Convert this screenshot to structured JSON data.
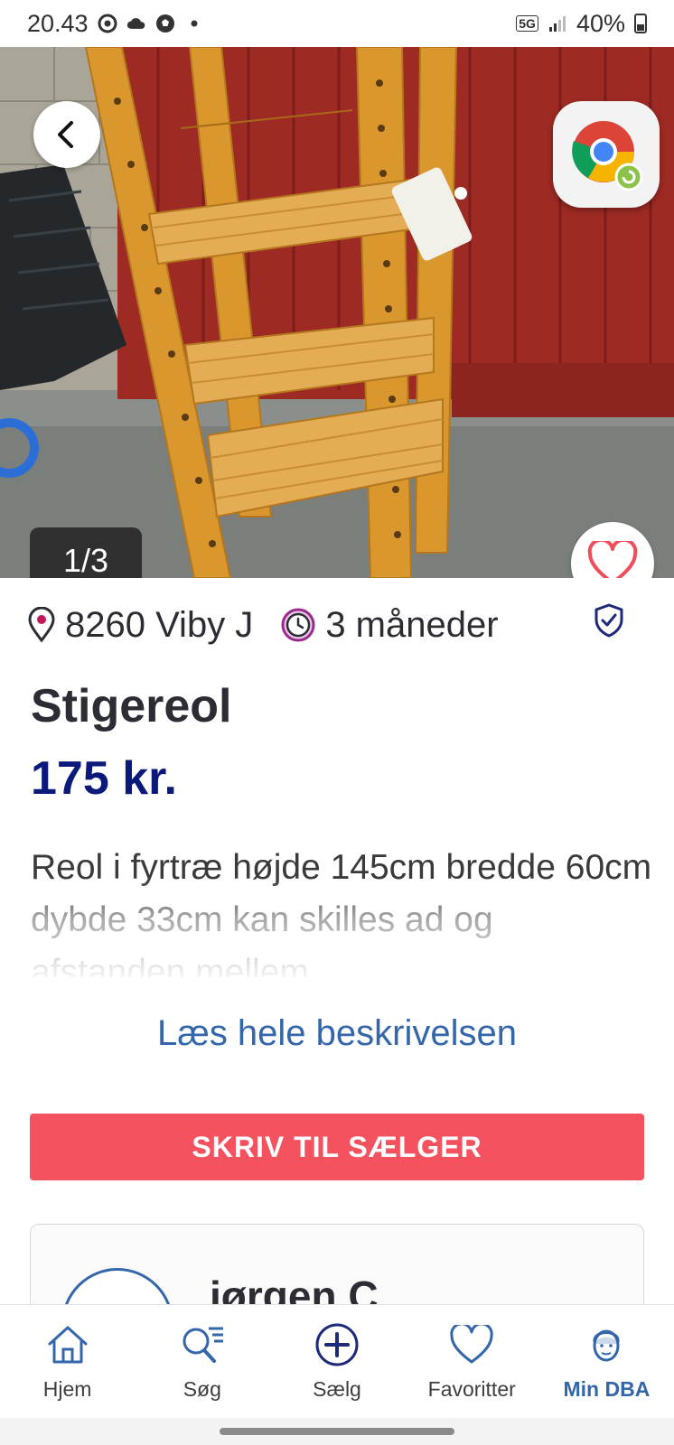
{
  "status_bar": {
    "time": "20.43",
    "network": "5G",
    "battery": "40%",
    "icons": [
      "chrome-status-icon",
      "cloud-icon",
      "football-icon",
      "dot-icon",
      "signal-icon",
      "battery-icon"
    ]
  },
  "listing": {
    "photo_counter": "1/3",
    "location": "8260 Viby J",
    "age": "3 måneder",
    "title": "Stigereol",
    "price": "175 kr.",
    "description": "Reol i fyrtræ højde 145cm bredde 60cm dybde 33cm kan skilles ad og afstanden mellem",
    "read_more": "Læs hele beskrivelsen",
    "contact_button": "SKRIV TIL SÆLGER"
  },
  "seller": {
    "name": "jørgen C."
  },
  "bottom_nav": {
    "items": [
      {
        "label": "Hjem",
        "icon": "home-icon",
        "active": false
      },
      {
        "label": "Søg",
        "icon": "search-icon",
        "active": false
      },
      {
        "label": "Sælg",
        "icon": "plus-circle-icon",
        "active": false
      },
      {
        "label": "Favoritter",
        "icon": "heart-icon",
        "active": false
      },
      {
        "label": "Min DBA",
        "icon": "profile-icon",
        "active": true
      }
    ]
  },
  "colors": {
    "price": "#0b1a7a",
    "accent": "#3466ab",
    "cta": "#f4525f",
    "heart": "#f04c5a"
  }
}
